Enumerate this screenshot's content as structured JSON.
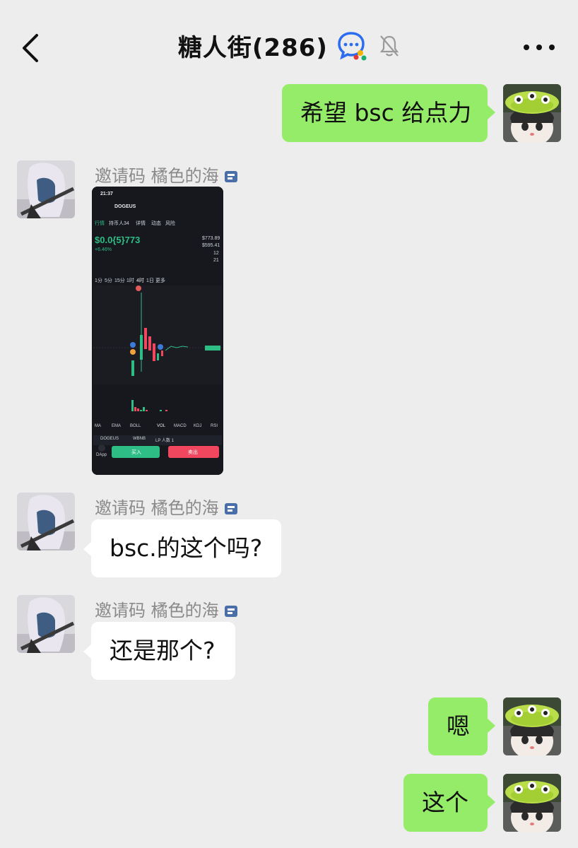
{
  "header": {
    "title": "糖人街(286)",
    "back_icon": "chevron-left-icon",
    "group_icon": "group-chat-icon",
    "mute_icon": "bell-muted-icon",
    "more_icon": "more-dots-icon"
  },
  "messages": [
    {
      "side": "right",
      "text": "希望 bsc 给点力"
    },
    {
      "side": "left",
      "sender": "邀请码 橘色的海",
      "type": "image"
    },
    {
      "side": "left",
      "sender": "邀请码 橘色的海",
      "text": "bsc.的这个吗?"
    },
    {
      "side": "left",
      "sender": "邀请码 橘色的海",
      "text": "还是那个?"
    },
    {
      "side": "right",
      "text": "嗯"
    },
    {
      "side": "right",
      "text": "这个"
    }
  ],
  "screenshot": {
    "time": "21:37",
    "token": "DOGEUS",
    "tabs": [
      "行情",
      "持币人34",
      "详情",
      "动态",
      "风险"
    ],
    "price": "$0.0{5}773",
    "change": "+6.46%",
    "stats": [
      "$773.89",
      "$595.41",
      "12",
      "21"
    ],
    "periods": [
      "1分",
      "5分",
      "15分",
      "1时",
      "4时",
      "1日",
      "更多"
    ],
    "indicators": [
      "MA",
      "EMA",
      "BOLL",
      "VOL",
      "MACD",
      "KDJ",
      "RSI"
    ],
    "buy_label": "买入",
    "sell_label": "卖出",
    "pair": "DOGEUS",
    "pair_quote": "WBNB",
    "lp_label": "LP 人数 1",
    "dapp_label": "DApp"
  },
  "colors": {
    "chat_bg": "#ededed",
    "green_bubble": "#95ec69",
    "white_bubble": "#ffffff",
    "buy": "#2dbd85",
    "sell": "#f0475e"
  }
}
